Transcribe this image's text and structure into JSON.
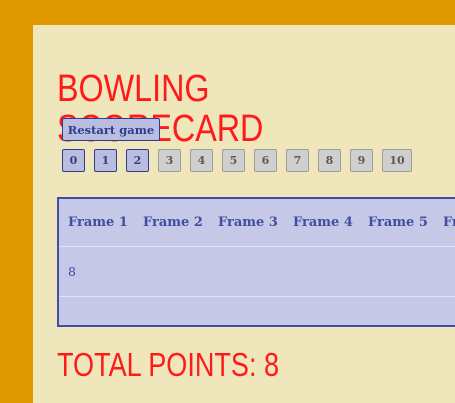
{
  "title": "BOWLING SCORECARD",
  "restart_label": "Restart game",
  "pins": [
    {
      "label": "0",
      "enabled": true
    },
    {
      "label": "1",
      "enabled": true
    },
    {
      "label": "2",
      "enabled": true
    },
    {
      "label": "3",
      "enabled": false
    },
    {
      "label": "4",
      "enabled": false
    },
    {
      "label": "5",
      "enabled": false
    },
    {
      "label": "6",
      "enabled": false
    },
    {
      "label": "7",
      "enabled": false
    },
    {
      "label": "8",
      "enabled": false
    },
    {
      "label": "9",
      "enabled": false
    },
    {
      "label": "10",
      "enabled": false
    }
  ],
  "frames": [
    {
      "header": "Frame 1",
      "roll": "8",
      "total": ""
    },
    {
      "header": "Frame 2",
      "roll": "",
      "total": ""
    },
    {
      "header": "Frame 3",
      "roll": "",
      "total": ""
    },
    {
      "header": "Frame 4",
      "roll": "",
      "total": ""
    },
    {
      "header": "Frame 5",
      "roll": "",
      "total": ""
    },
    {
      "header": "Fr",
      "roll": "",
      "total": ""
    }
  ],
  "total_label": "TOTAL POINTS: 8",
  "colors": {
    "page_bg": "#e09a00",
    "card_bg": "#f0e6bb",
    "title": "#ff1a1a",
    "accent": "#3f4ea0"
  }
}
